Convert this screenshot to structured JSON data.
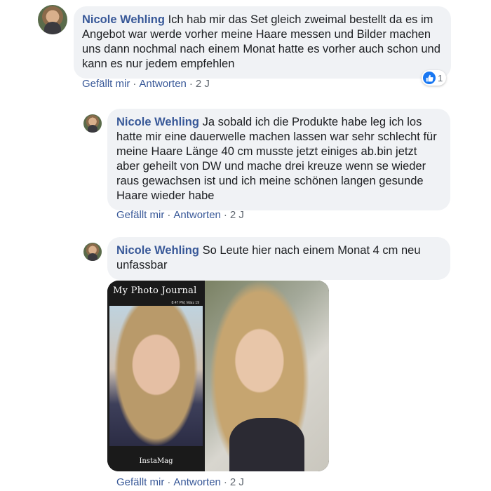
{
  "comments": [
    {
      "author": "Nicole Wehling",
      "text": "Ich hab mir das Set gleich zweimal bestellt da es im Angebot war werde vorher meine Haare messen und Bilder machen uns dann nochmal nach einem Monat hatte es vorher auch schon und kann es nur jedem empfehlen",
      "like_label": "Gefällt mir",
      "reply_label": "Antworten",
      "separator": "·",
      "age": "2 J",
      "reaction_count": "1"
    },
    {
      "author": "Nicole Wehling",
      "text": "Ja sobald ich die Produkte habe leg ich los hatte mir eine dauerwelle machen lassen war sehr schlecht für meine Haare Länge 40 cm musste jetzt einiges ab.bin jetzt aber geheilt von DW und mache drei kreuze wenn se wieder raus gewachsen ist und ich meine schönen langen gesunde Haare wieder habe",
      "like_label": "Gefällt mir",
      "reply_label": "Antworten",
      "separator": "·",
      "age": "2 J"
    },
    {
      "author": "Nicole Wehling",
      "text": "So Leute hier nach einem Monat 4 cm neu unfassbar",
      "like_label": "Gefällt mir",
      "reply_label": "Antworten",
      "separator": "·",
      "age": "2 J",
      "photo": {
        "journal_title": "My Photo Journal",
        "journal_date": "8:47 PM, März 19",
        "footer_text": "InstaMag"
      }
    }
  ],
  "colors": {
    "link": "#385898",
    "bubble": "#f0f2f5",
    "like_blue": "#1877f2",
    "meta_gray": "#606770"
  }
}
